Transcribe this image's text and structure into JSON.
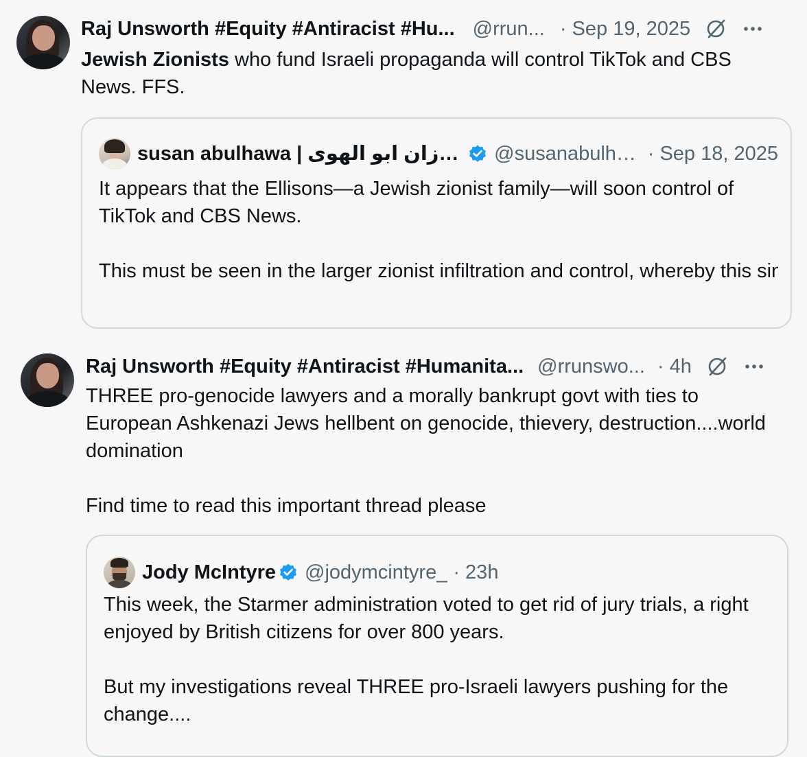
{
  "tweets": [
    {
      "display_name": "Raj Unsworth #Equity #Antiracist #Hu...",
      "handle": "@rrun...",
      "date": "· Sep 19, 2025",
      "text_bold": "Jewish Zionists",
      "text_rest": " who fund Israeli propaganda will control TikTok and CBS News. FFS.",
      "quote": {
        "display_name": "susan abulhawa | سوزان ابو الهوى..",
        "handle": "@susanabulha...",
        "date": "· Sep 18, 2025",
        "paragraphs": [
          "It appears that the Ellisons—a Jewish zionist family—will soon control of TikTok and CBS News.",
          "This must be seen in the larger zionist infiltration and control, whereby this singular family will have inordinate power over American and worl..."
        ]
      }
    },
    {
      "display_name": "Raj Unsworth #Equity #Antiracist #Humanita...",
      "handle": "@rrunswo...",
      "date": "· 4h",
      "paragraphs": [
        "THREE pro-genocide lawyers and a morally bankrupt govt with ties to European Ashkenazi Jews hellbent on genocide, thievery, destruction....world domination",
        "Find time to read this important thread please"
      ],
      "quote": {
        "display_name": "Jody McIntyre",
        "handle": "@jodymcintyre_",
        "date": "· 23h",
        "paragraphs": [
          "This week, the Starmer administration voted to get rid of jury trials, a right enjoyed by British citizens for over 800 years.",
          "But my investigations reveal THREE pro-Israeli lawyers pushing for the change...."
        ]
      }
    }
  ],
  "icons": {
    "grok": "grok-slash-icon",
    "more": "more-options-icon",
    "verified": "verified-badge-icon"
  },
  "colors": {
    "background": "#f7f7f7",
    "text": "#0f1419",
    "secondary": "#536471",
    "border": "#cfd9de",
    "verified": "#1d9bf0"
  }
}
